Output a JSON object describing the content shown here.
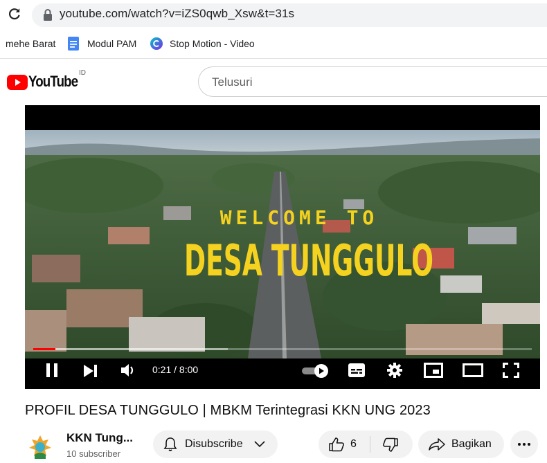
{
  "browser": {
    "url": "youtube.com/watch?v=iZS0qwb_Xsw&t=31s",
    "bookmarks": [
      {
        "label": "mehe Barat",
        "icon": "none"
      },
      {
        "label": "Modul PAM",
        "icon": "docs-icon"
      },
      {
        "label": "Stop Motion - Video",
        "icon": "canva-icon"
      }
    ]
  },
  "header": {
    "logo_text": "YouTube",
    "region": "ID",
    "search_placeholder": "Telusuri"
  },
  "player": {
    "overlay_line1": "WELCOME TO",
    "overlay_line2": "DESA TUNGGULO",
    "time": "0:21 / 8:00",
    "progress_fraction": 0.044,
    "buffer_fraction": 0.39
  },
  "video": {
    "title": "PROFIL DESA TUNGGULO | MBKM Terintegrasi KKN UNG 2023"
  },
  "channel": {
    "name": "KKN Tung...",
    "subscribers": "10 subscriber"
  },
  "actions": {
    "subscribe_label": "Disubscribe",
    "like_count": "6",
    "share_label": "Bagikan"
  },
  "colors": {
    "youtube_red": "#ff0000",
    "overlay_yellow": "#f4d21f",
    "progress_red": "#ff0000"
  }
}
